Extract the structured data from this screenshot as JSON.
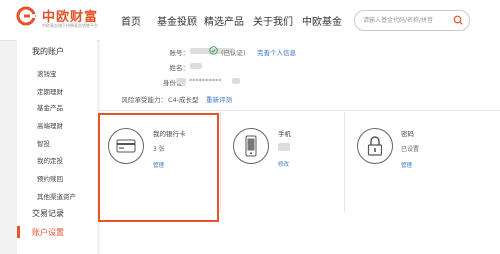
{
  "brand": {
    "name": "中欧财富",
    "tagline": "中欧基金旗下持牌基金销售平台",
    "color": "#e4542a"
  },
  "nav": {
    "items": [
      "首页",
      "基金投顾",
      "精选产品",
      "关于我们",
      "中欧基金"
    ]
  },
  "search": {
    "placeholder": "请输入基金代码/名称/拼音",
    "icon": "search-icon"
  },
  "sidebar": {
    "title": "我的账户",
    "items": [
      "滚钱宝",
      "定期理财",
      "基金产品",
      "高端理财",
      "智投",
      "我的定投",
      "预约赎回",
      "其他渠道资产"
    ],
    "sections": [
      "交易记录",
      "账户设置"
    ],
    "active": "账户设置"
  },
  "account": {
    "account_label": "账号：",
    "verified": "已认证",
    "complete_info": "完善个人信息",
    "name_label": "姓名：",
    "id_label": "身份证：",
    "id_value": "**********",
    "risk_label": "风险承受能力：",
    "risk_value": "C4-成长型",
    "risk_retest": "重新评测"
  },
  "cards": {
    "bank": {
      "title": "我的银行卡",
      "count": "3 张",
      "action": "管理",
      "icon": "bank-card-icon"
    },
    "phone": {
      "title": "手机",
      "action": "修改",
      "icon": "mobile-phone-icon"
    },
    "password": {
      "title": "密码",
      "status": "已设置",
      "action": "管理",
      "icon": "lock-icon"
    }
  },
  "link_color": "#3a78c8"
}
